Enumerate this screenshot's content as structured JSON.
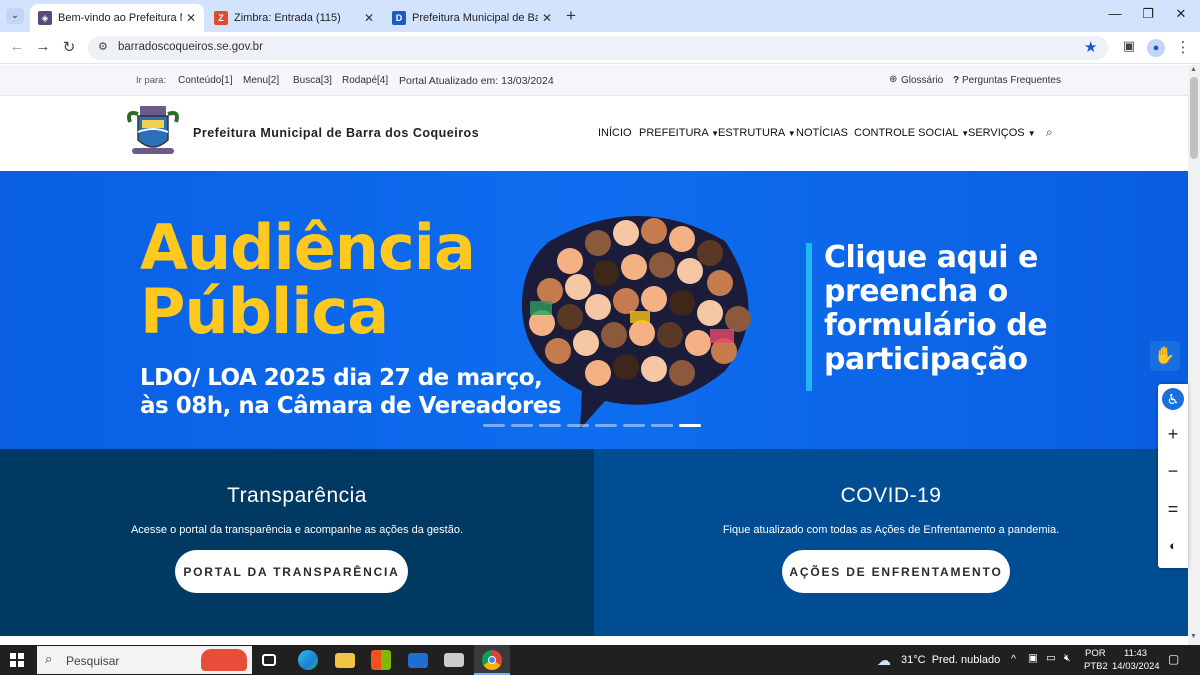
{
  "browser": {
    "tabs": [
      {
        "title": "Bem-vindo ao Prefeitura Munic",
        "icon": "prefeitura-crest-icon",
        "active": true
      },
      {
        "title": "Zimbra: Entrada (115)",
        "icon": "zimbra-icon",
        "active": false
      },
      {
        "title": "Prefeitura Municipal de Barra d",
        "icon": "d-logo-icon",
        "active": false
      }
    ],
    "url": "barradoscoqueiros.se.gov.br"
  },
  "utility": {
    "label": "Ir para:",
    "links": [
      "Conteúdo[1]",
      "Menu[2]",
      "Busca[3]",
      "Rodapé[4]"
    ],
    "updated": "Portal Atualizado em: 13/03/2024",
    "glossary": "Glossário",
    "faq": "Perguntas Frequentes"
  },
  "header": {
    "brand": "Prefeitura Municipal de Barra dos Coqueiros",
    "menu": [
      "INÍCIO",
      "PREFEITURA",
      "ESTRUTURA",
      "NOTÍCIAS",
      "CONTROLE SOCIAL",
      "SERVIÇOS"
    ]
  },
  "hero": {
    "title_line1": "Audiência",
    "title_line2": "Pública",
    "sub_line1": "LDO/ LOA 2025 dia 27 de março,",
    "sub_line2": "às 08h, na Câmara de Vereadores",
    "cta_lines": [
      "Clique aqui e",
      "preencha o",
      "formulário de",
      "participação"
    ],
    "slides": 8,
    "active_slide": 8,
    "colors": {
      "background": "#0e6df0",
      "title": "#ffc81f",
      "accent_bar": "#1fb8f2"
    }
  },
  "cards": {
    "transparencia": {
      "title": "Transparência",
      "text": "Acesse o portal da transparência e acompanhe as ações da gestão.",
      "button": "PORTAL DA TRANSPARÊNCIA",
      "color": "#003a63"
    },
    "covid": {
      "title": "COVID-19",
      "text": "Fique atualizado com todas as Ações de Enfrentamento a pandemia.",
      "button": "AÇÕES DE ENFRENTAMENTO",
      "color": "#004d94"
    }
  },
  "accessibility": {
    "items": [
      "accessibility-icon",
      "zoom-in",
      "zoom-out",
      "reset",
      "contrast"
    ]
  },
  "taskbar": {
    "search_placeholder": "Pesquisar",
    "weather": "31°C  Pred. nublado",
    "lang1": "POR",
    "lang2": "PTB2",
    "time": "11:43",
    "date": "14/03/2024"
  }
}
